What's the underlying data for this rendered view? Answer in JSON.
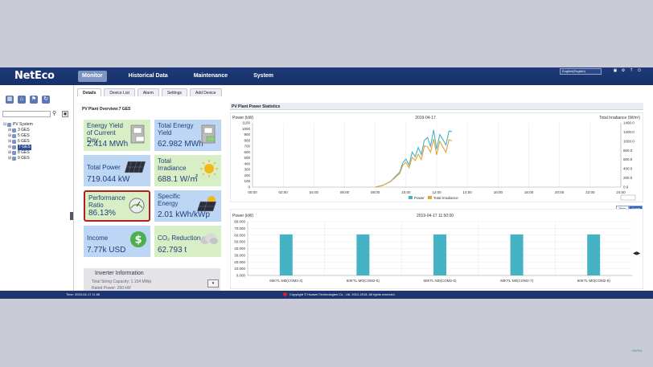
{
  "app": {
    "logo": "NetEco",
    "nav": [
      "Monitor",
      "Historical Data",
      "Maintenance",
      "System"
    ],
    "language": "English(English)",
    "header_icons": [
      "lock-icon",
      "settings-icon",
      "help-icon",
      "power-icon"
    ],
    "header_glyphs": [
      "▣",
      "⚙",
      "?",
      "⏻"
    ]
  },
  "sidebar": {
    "tree_root": "PV System",
    "tree_items": [
      "3 GES",
      "5 GES",
      "6 GES",
      "7 GES",
      "8 GES",
      "9 GES"
    ],
    "selected_index": 3
  },
  "tabs": [
    "Details",
    "Device List",
    "Alarm",
    "Settings",
    "Add Device"
  ],
  "overview": {
    "title": "PV Plant Overview:7 GES",
    "cards": [
      {
        "label": "Energy Yield of Current Day",
        "value": "2.414 MWh",
        "icon": "meter-icon",
        "color": "green"
      },
      {
        "label": "Total Energy Yield",
        "value": "62.982 MWh",
        "icon": "meter-icon",
        "color": "blue"
      },
      {
        "label": "Total Power",
        "value": "719.044 kW",
        "icon": "solar-panel-icon",
        "color": "blue"
      },
      {
        "label": "Total Irradiance",
        "value": "688.1 W/㎡",
        "icon": "sun-icon",
        "color": "green"
      },
      {
        "label": "Performance Ratio",
        "value": "86.13%",
        "icon": "gauge-icon",
        "color": "green"
      },
      {
        "label": "Specific Energy",
        "value": "2.01 kWh/kWp",
        "icon": "solar-sun-icon",
        "color": "blue"
      },
      {
        "label": "Income",
        "value": "7.77k USD",
        "icon": "dollar-icon",
        "color": "blue"
      },
      {
        "label": "CO₂ Reduction",
        "value": "62.793 t",
        "icon": "cloud-icon",
        "color": "green"
      }
    ],
    "inverter": {
      "title": "Inverter Information",
      "capacity": "Total String Capacity:  1.154 MWp",
      "rated": "Rated Power:  260 kW"
    }
  },
  "stats": {
    "title": "PV Plant Power Statistics",
    "toggle": [
      "Table",
      "Graph"
    ]
  },
  "chart_data": [
    {
      "type": "line",
      "title": "2019-04-17",
      "ylabel": "Power (kW)",
      "y2label": "Total Irradiance (W/m²)",
      "x": [
        "00:00",
        "02:00",
        "04:00",
        "06:00",
        "08:00",
        "10:00",
        "12:00",
        "14:00",
        "16:00",
        "18:00",
        "20:00",
        "22:00",
        "24:00"
      ],
      "ylim": [
        0,
        1100
      ],
      "y2lim": [
        0,
        1400
      ],
      "yticks": [
        0,
        100,
        200,
        300,
        400,
        500,
        600,
        700,
        800,
        900,
        1000,
        1100
      ],
      "y2ticks": [
        0,
        200,
        400,
        600,
        800,
        1000,
        1200,
        1400
      ],
      "series": [
        {
          "name": "Power",
          "color": "#46b3c4",
          "points": [
            [
              8.0,
              0
            ],
            [
              8.5,
              30
            ],
            [
              9.0,
              100
            ],
            [
              9.3,
              180
            ],
            [
              9.6,
              260
            ],
            [
              9.8,
              420
            ],
            [
              10.0,
              480
            ],
            [
              10.2,
              380
            ],
            [
              10.4,
              600
            ],
            [
              10.6,
              520
            ],
            [
              10.8,
              680
            ],
            [
              11.0,
              560
            ],
            [
              11.2,
              800
            ],
            [
              11.4,
              850
            ],
            [
              11.6,
              700
            ],
            [
              11.8,
              980
            ],
            [
              12.0,
              650
            ],
            [
              12.2,
              900
            ],
            [
              12.4,
              820
            ],
            [
              12.6,
              720
            ],
            [
              12.8,
              960
            ],
            [
              13.0,
              950
            ]
          ]
        },
        {
          "name": "Total Irradiance",
          "color": "#e2a33a",
          "points": [
            [
              8.0,
              0
            ],
            [
              8.5,
              40
            ],
            [
              9.0,
              120
            ],
            [
              9.3,
              210
            ],
            [
              9.6,
              300
            ],
            [
              9.8,
              480
            ],
            [
              10.0,
              540
            ],
            [
              10.2,
              420
            ],
            [
              10.4,
              650
            ],
            [
              10.6,
              580
            ],
            [
              10.8,
              720
            ],
            [
              11.0,
              600
            ],
            [
              11.2,
              900
            ],
            [
              11.4,
              880
            ],
            [
              11.6,
              760
            ],
            [
              11.8,
              1050
            ],
            [
              12.0,
              700
            ],
            [
              12.2,
              1000
            ],
            [
              12.4,
              880
            ],
            [
              12.6,
              760
            ],
            [
              12.8,
              1030
            ],
            [
              13.0,
              1010
            ]
          ]
        }
      ]
    },
    {
      "type": "bar",
      "title": "2019-04-17 11:50:00",
      "ylabel": "Power (kW)",
      "categories": [
        "60KTL-M0(COM2-4)",
        "60KTL-M0(COM2-6)",
        "60KTL-M0(COM2-5)",
        "60KTL-M0(COM2-7)",
        "60KTL-M0(COM2-8)"
      ],
      "values": [
        61000,
        61000,
        61000,
        61000,
        61000
      ],
      "ylim": [
        0,
        80000
      ],
      "yticks": [
        "0.000",
        "10.000",
        "20.000",
        "30.000",
        "40.000",
        "50.000",
        "60.000",
        "70.000",
        "80.000"
      ],
      "color": "#46b3c4"
    }
  ],
  "footer": {
    "time": "Time:  2019-04-17 11:56",
    "copyright": "Copyright © Huawei Technologies Co., Ltd. 2012-2018. All rights reserved."
  },
  "watermark": "HIVEN"
}
